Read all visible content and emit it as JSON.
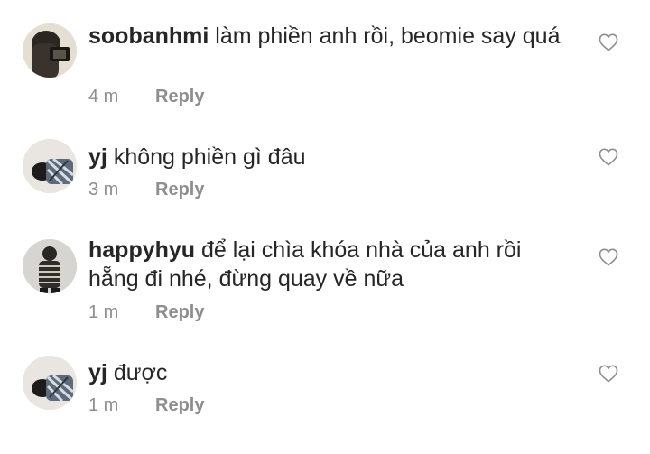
{
  "comments": [
    {
      "username": "soobanhmi",
      "text": "làm phiền anh rồi, beomie say quá",
      "time": "4 m",
      "reply_label": "Reply",
      "like_icon": "heart-outline-icon"
    },
    {
      "username": "yj",
      "text": "không phiền gì đâu",
      "time": "3 m",
      "reply_label": "Reply",
      "like_icon": "heart-outline-icon"
    },
    {
      "username": "happyhyu",
      "text": "để lại chìa khóa nhà của anh rồi hẵng đi nhé, đừng quay về nữa",
      "time": "1 m",
      "reply_label": "Reply",
      "like_icon": "heart-outline-icon"
    },
    {
      "username": "yj",
      "text": "được",
      "time": "1 m",
      "reply_label": "Reply",
      "like_icon": "heart-outline-icon"
    }
  ],
  "colors": {
    "text": "#262626",
    "secondary": "#8e8e8e",
    "background": "#ffffff"
  }
}
